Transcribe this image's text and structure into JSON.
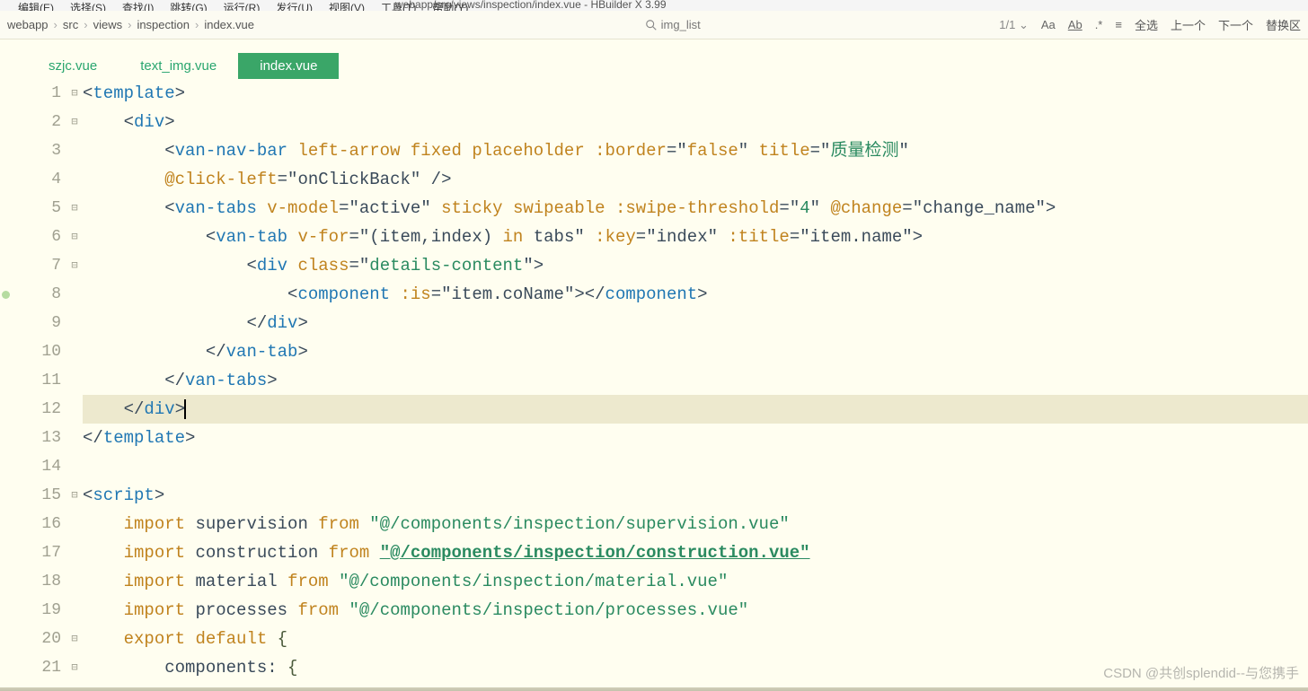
{
  "menubar": {
    "items": [
      "编辑(E)",
      "选择(S)",
      "查找(I)",
      "跳转(G)",
      "运行(R)",
      "发行(U)",
      "视图(V)",
      "工具(T)",
      "帮助(Y)"
    ]
  },
  "title": "webapp/src/views/inspection/index.vue - HBuilder X 3.99",
  "breadcrumbs": [
    "webapp",
    "src",
    "views",
    "inspection",
    "index.vue"
  ],
  "search": {
    "text": "img_list"
  },
  "rightbar": {
    "counter": "1/1 ⌄",
    "select_all": "全选",
    "prev": "上一个",
    "next": "下一个",
    "replace": "替换区"
  },
  "tabs": [
    {
      "label": "szjc.vue",
      "active": false
    },
    {
      "label": "text_img.vue",
      "active": false
    },
    {
      "label": "index.vue",
      "active": true
    }
  ],
  "code_lines": [
    {
      "n": 1,
      "fold": "⊟",
      "html": "<span class='p'>&lt;</span><span class='tg'>template</span><span class='p'>&gt;</span>"
    },
    {
      "n": 2,
      "fold": "⊟",
      "html": "    <span class='p'>&lt;</span><span class='tg'>div</span><span class='p'>&gt;</span>"
    },
    {
      "n": 3,
      "fold": "",
      "html": "        <span class='p'>&lt;</span><span class='tg'>van-nav-bar</span> <span class='at'>left-arrow</span> <span class='at'>fixed</span> <span class='at'>placeholder</span> <span class='at'>:border</span><span class='eq'>=</span><span class='p'>\"</span><span class='at'>false</span><span class='p'>\"</span> <span class='at'>title</span><span class='eq'>=</span><span class='p'>\"</span><span class='st'>质量检测</span><span class='p'>\"</span>"
    },
    {
      "n": 4,
      "fold": "",
      "html": "        <span class='at'>@click-left</span><span class='eq'>=</span><span class='p'>\"</span><span class='id'>onClickBack</span><span class='p'>\" /&gt;</span>"
    },
    {
      "n": 5,
      "fold": "⊟",
      "html": "        <span class='p'>&lt;</span><span class='tg'>van-tabs</span> <span class='at'>v-model</span><span class='eq'>=</span><span class='p'>\"</span><span class='id'>active</span><span class='p'>\"</span> <span class='at'>sticky</span> <span class='at'>swipeable</span> <span class='at'>:swipe-threshold</span><span class='eq'>=</span><span class='p'>\"</span><span class='st'>4</span><span class='p'>\"</span> <span class='at'>@change</span><span class='eq'>=</span><span class='p'>\"</span><span class='id'>change_name</span><span class='p'>\"&gt;</span>"
    },
    {
      "n": 6,
      "fold": "⊟",
      "html": "            <span class='p'>&lt;</span><span class='tg'>van-tab</span> <span class='at'>v-for</span><span class='eq'>=</span><span class='p'>\"</span><span class='id'>(item,index)</span> <span class='at'>in</span> <span class='id'>tabs</span><span class='p'>\"</span> <span class='at'>:key</span><span class='eq'>=</span><span class='p'>\"</span><span class='id'>index</span><span class='p'>\"</span> <span class='at'>:title</span><span class='eq'>=</span><span class='p'>\"</span><span class='id'>item.name</span><span class='p'>\"&gt;</span>"
    },
    {
      "n": 7,
      "fold": "⊟",
      "html": "                <span class='p'>&lt;</span><span class='tg'>div</span> <span class='at'>class</span><span class='eq'>=</span><span class='p'>\"</span><span class='st'>details-content</span><span class='p'>\"&gt;</span>"
    },
    {
      "n": 8,
      "fold": "",
      "html": "                    <span class='p'>&lt;</span><span class='tg'>component</span> <span class='at'>:is</span><span class='eq'>=</span><span class='p'>\"</span><span class='id'>item.coName</span><span class='p'>\"&gt;&lt;/</span><span class='tg'>component</span><span class='p'>&gt;</span>"
    },
    {
      "n": 9,
      "fold": "",
      "html": "                <span class='p'>&lt;/</span><span class='tg'>div</span><span class='p'>&gt;</span>"
    },
    {
      "n": 10,
      "fold": "",
      "html": "            <span class='p'>&lt;/</span><span class='tg'>van-tab</span><span class='p'>&gt;</span>"
    },
    {
      "n": 11,
      "fold": "",
      "html": "        <span class='p'>&lt;/</span><span class='tg'>van-tabs</span><span class='p'>&gt;</span>"
    },
    {
      "n": 12,
      "fold": "",
      "hl": true,
      "html": "    <span class='p'>&lt;/</span><span class='tg'>div</span><span class='p'>&gt;</span><span class='cursor'></span>"
    },
    {
      "n": 13,
      "fold": "",
      "html": "<span class='p'>&lt;/</span><span class='tg'>template</span><span class='p'>&gt;</span>"
    },
    {
      "n": 14,
      "fold": "",
      "html": ""
    },
    {
      "n": 15,
      "fold": "⊟",
      "html": "<span class='p'>&lt;</span><span class='tg'>script</span><span class='p'>&gt;</span>"
    },
    {
      "n": 16,
      "fold": "",
      "html": "    <span class='kw'>import</span> <span class='id'>supervision</span> <span class='kw'>from</span> <span class='st'>\"@/components/inspection/supervision.vue\"</span>"
    },
    {
      "n": 17,
      "fold": "",
      "html": "    <span class='kw'>import</span> <span class='id'>construction</span> <span class='kw'>from</span> <span class='st-u'>\"@/components/inspection/construction.vue\"</span>"
    },
    {
      "n": 18,
      "fold": "",
      "html": "    <span class='kw'>import</span> <span class='id'>material</span> <span class='kw'>from</span> <span class='st'>\"@/components/inspection/material.vue\"</span>"
    },
    {
      "n": 19,
      "fold": "",
      "html": "    <span class='kw'>import</span> <span class='id'>processes</span> <span class='kw'>from</span> <span class='st'>\"@/components/inspection/processes.vue\"</span>"
    },
    {
      "n": 20,
      "fold": "⊟",
      "html": "    <span class='kw'>export</span> <span class='kw'>default</span> <span class='br'>{</span>"
    },
    {
      "n": 21,
      "fold": "⊟",
      "html": "        <span class='id'>components:</span> <span class='br'>{</span>"
    }
  ],
  "bp_dots": [
    8
  ],
  "watermark": "CSDN @共创splendid--与您携手"
}
